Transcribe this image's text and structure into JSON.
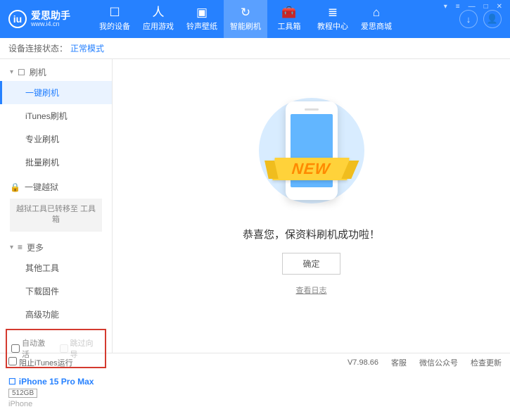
{
  "app": {
    "title": "爱思助手",
    "url": "www.i4.cn",
    "logo_letter": "iu"
  },
  "win": {
    "menu": "▾",
    "list": "≡",
    "min": "—",
    "max": "□",
    "close": "✕"
  },
  "nav": [
    {
      "label": "我的设备",
      "icon": "☐"
    },
    {
      "label": "应用游戏",
      "icon": "人"
    },
    {
      "label": "铃声壁纸",
      "icon": "▣"
    },
    {
      "label": "智能刷机",
      "icon": "↻"
    },
    {
      "label": "工具箱",
      "icon": "🧰"
    },
    {
      "label": "教程中心",
      "icon": "≣"
    },
    {
      "label": "爱思商城",
      "icon": "⌂"
    }
  ],
  "header_right": {
    "download": "↓",
    "user": "👤"
  },
  "status": {
    "label": "设备连接状态：",
    "mode": "正常模式"
  },
  "sidebar": {
    "sections": {
      "flash": {
        "label": "刷机",
        "icon": "☐"
      },
      "jailbreak": {
        "label": "一键越狱",
        "icon": "🔒"
      },
      "more": {
        "label": "更多",
        "icon": "≡"
      }
    },
    "flash_items": [
      "一键刷机",
      "iTunes刷机",
      "专业刷机",
      "批量刷机"
    ],
    "jailbreak_note": "越狱工具已转移至\n工具箱",
    "more_items": [
      "其他工具",
      "下载固件",
      "高级功能"
    ],
    "checks": {
      "auto_activate": "自动激活",
      "skip_guide": "跳过向导"
    },
    "device": {
      "name": "iPhone 15 Pro Max",
      "storage": "512GB",
      "type": "iPhone",
      "icon": "☐"
    }
  },
  "main": {
    "ribbon": "NEW",
    "message": "恭喜您，保资料刷机成功啦！",
    "ok": "确定",
    "log": "查看日志"
  },
  "footer": {
    "block_itunes": "阻止iTunes运行",
    "version": "V7.98.66",
    "links": [
      "客服",
      "微信公众号",
      "检查更新"
    ]
  }
}
